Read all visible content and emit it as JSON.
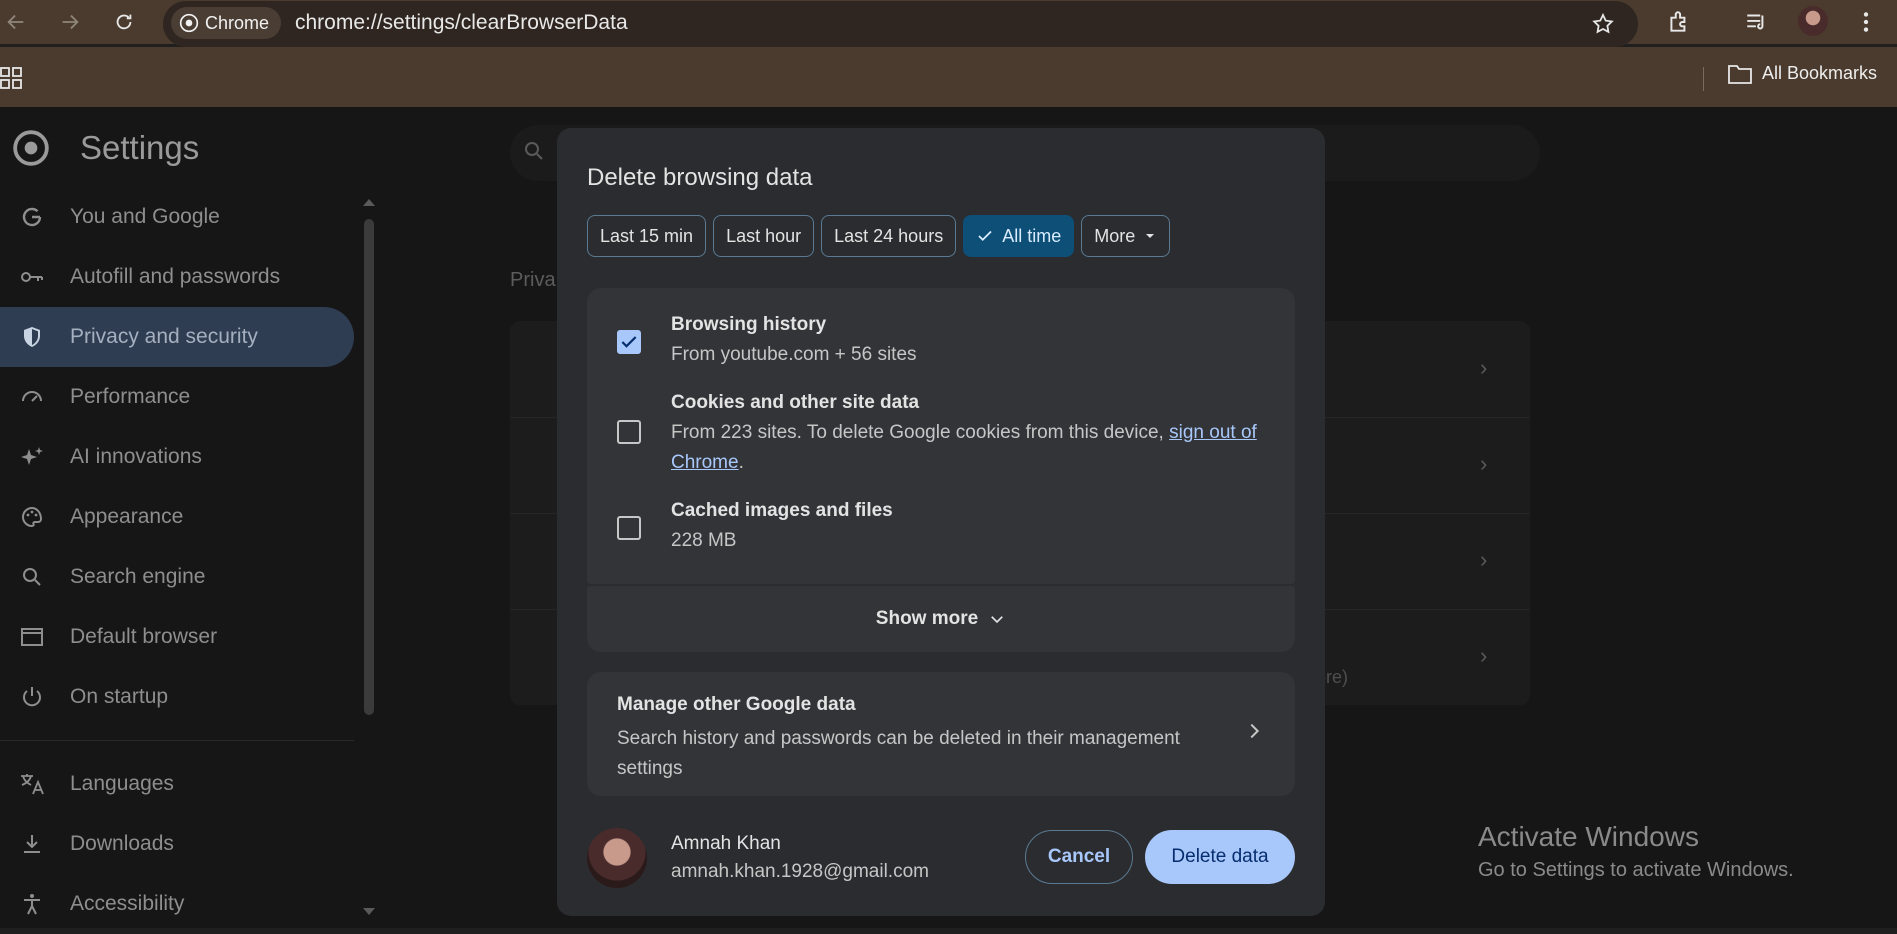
{
  "browser": {
    "chip_label": "Chrome",
    "url": "chrome://settings/clearBrowserData",
    "all_bookmarks": "All Bookmarks"
  },
  "settings": {
    "title": "Settings",
    "nav_items": [
      {
        "label": "You and Google",
        "icon": "google-g-icon"
      },
      {
        "label": "Autofill and passwords",
        "icon": "key-icon"
      },
      {
        "label": "Privacy and security",
        "icon": "shield-icon",
        "active": true
      },
      {
        "label": "Performance",
        "icon": "gauge-icon"
      },
      {
        "label": "AI innovations",
        "icon": "sparkle-icon"
      },
      {
        "label": "Appearance",
        "icon": "palette-icon"
      },
      {
        "label": "Search engine",
        "icon": "search-icon"
      },
      {
        "label": "Default browser",
        "icon": "browser-window-icon"
      },
      {
        "label": "On startup",
        "icon": "power-icon"
      },
      {
        "label": "Languages",
        "icon": "translate-icon"
      },
      {
        "label": "Downloads",
        "icon": "download-icon"
      },
      {
        "label": "Accessibility",
        "icon": "accessibility-icon"
      }
    ],
    "bg_section_label": "Priva",
    "bg_partial_text": "ore)"
  },
  "dialog": {
    "title": "Delete browsing data",
    "time_ranges": [
      "Last 15 min",
      "Last hour",
      "Last 24 hours",
      "All time",
      "More"
    ],
    "selected_range": "All time",
    "options": [
      {
        "title": "Browsing history",
        "sub": "From youtube.com + 56 sites",
        "checked": true
      },
      {
        "title": "Cookies and other site data",
        "sub": "From 223 sites. To delete Google cookies from this device, ",
        "link": "sign out of Chrome",
        "after": ".",
        "checked": false
      },
      {
        "title": "Cached images and files",
        "sub": "228 MB",
        "checked": false
      }
    ],
    "show_more": "Show more",
    "manage": {
      "title": "Manage other Google data",
      "sub": "Search history and passwords can be deleted in their management settings"
    },
    "account": {
      "name": "Amnah Khan",
      "email": "amnah.khan.1928@gmail.com"
    },
    "cancel": "Cancel",
    "delete": "Delete data"
  },
  "watermark": {
    "line1": "Activate Windows",
    "line2": "Go to Settings to activate Windows."
  }
}
